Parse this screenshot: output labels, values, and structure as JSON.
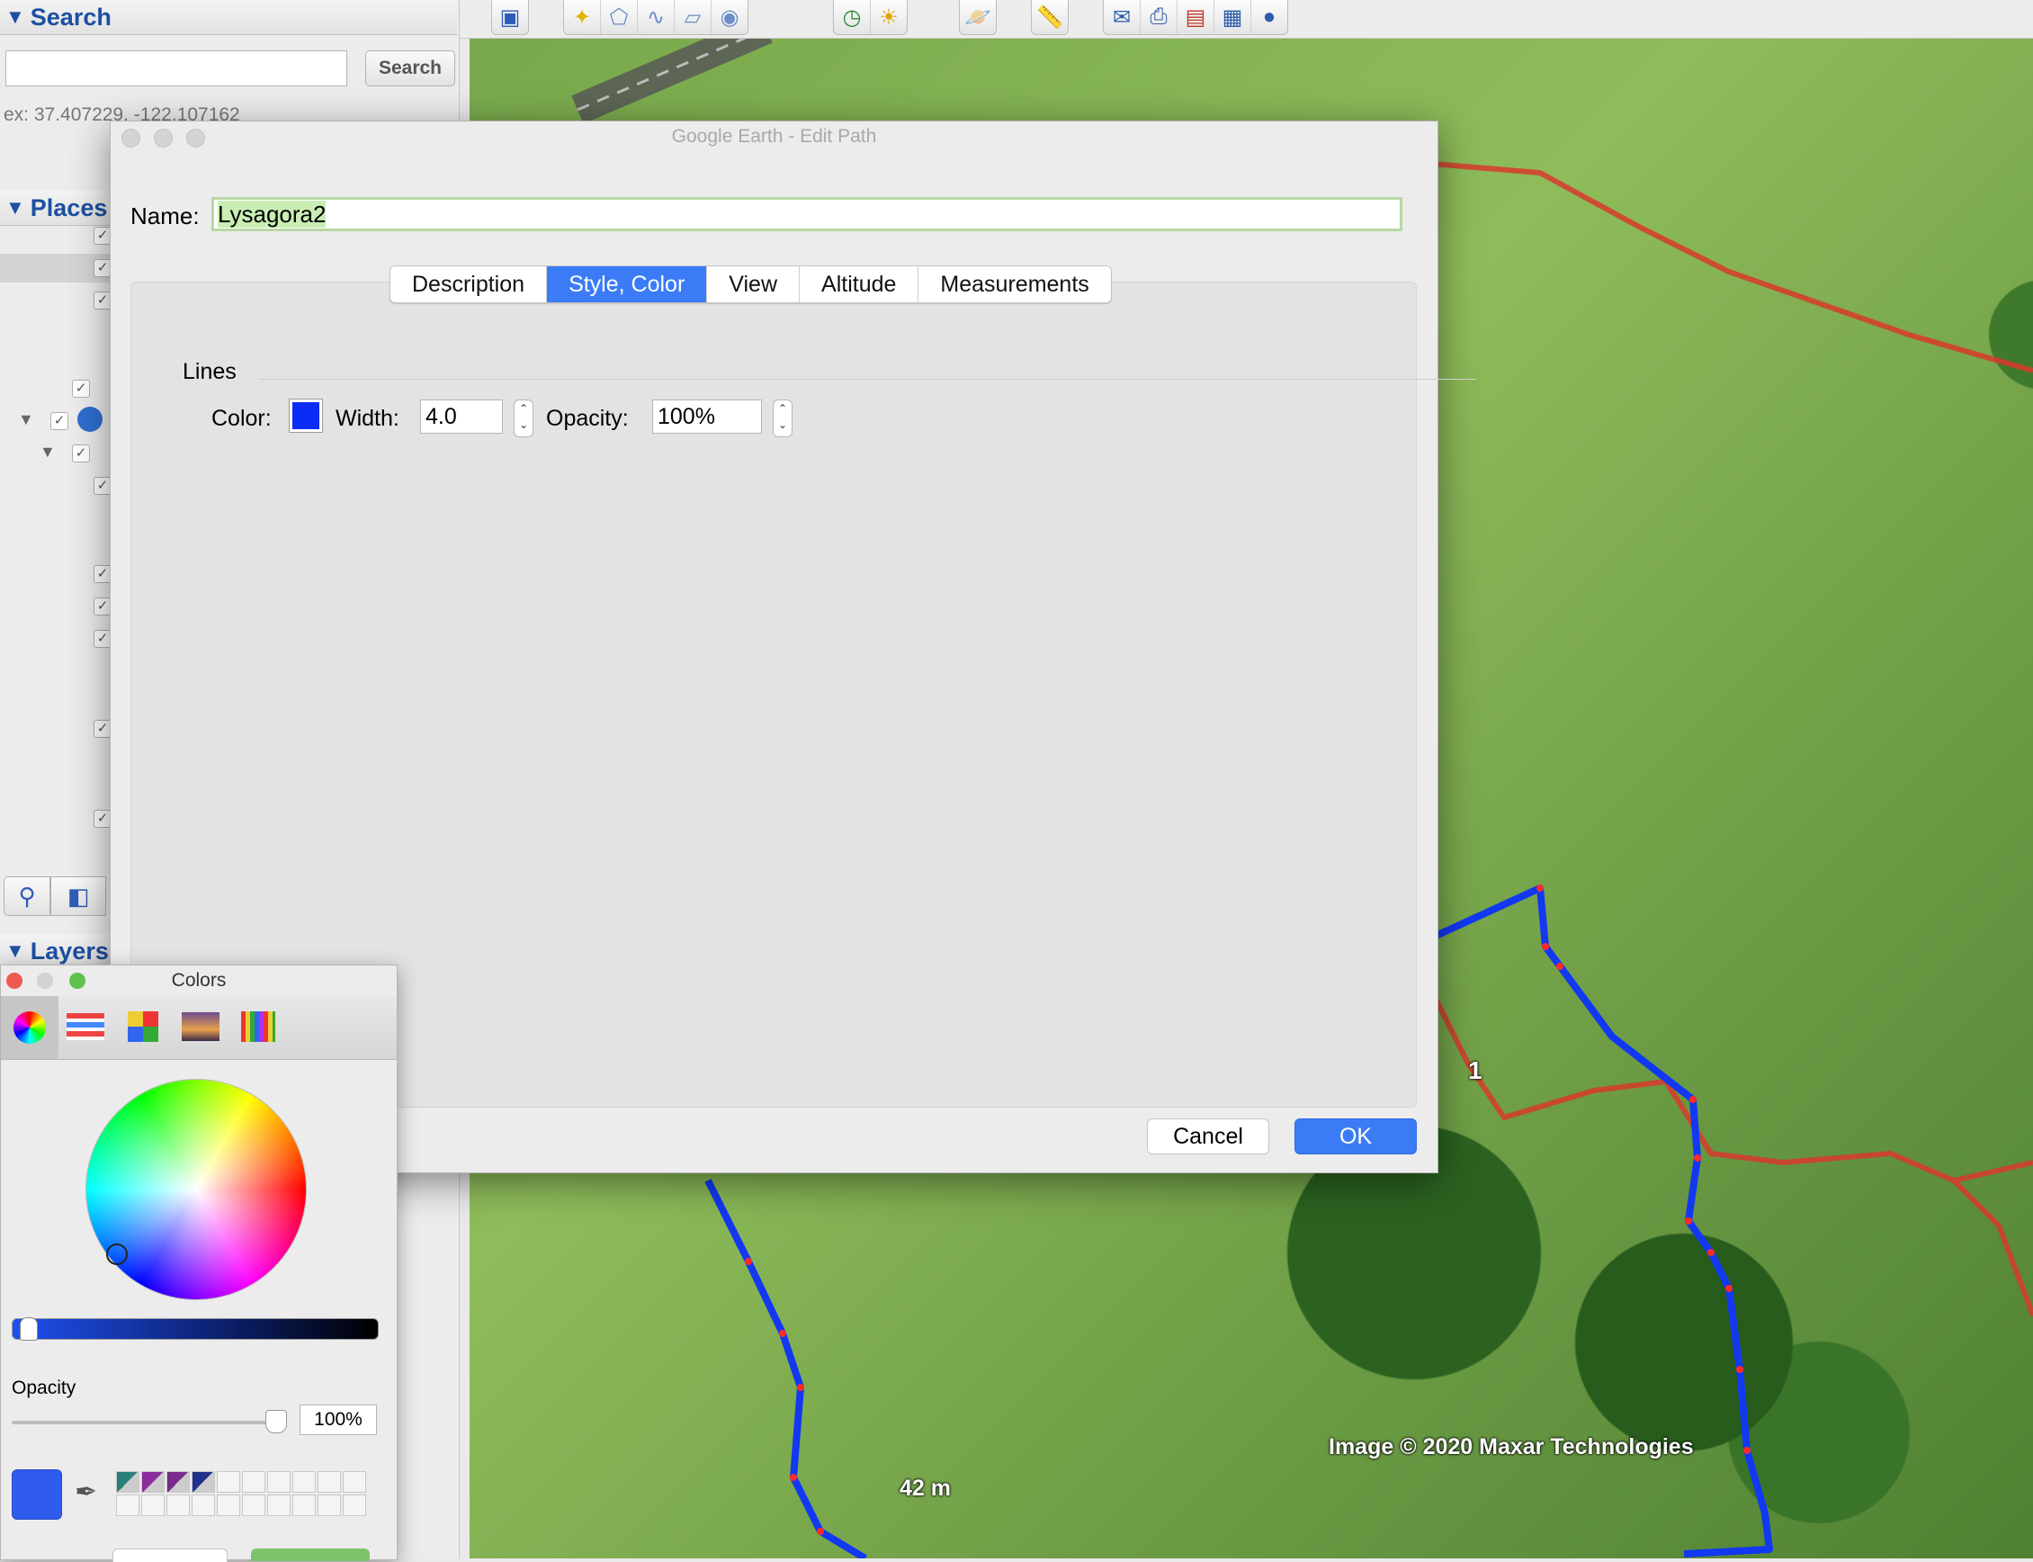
{
  "sidebar": {
    "search_header": "Search",
    "search_button": "Search",
    "search_hint": "ex: 37.407229, -122.107162",
    "places_header": "Places",
    "layers_header": "Layers"
  },
  "map": {
    "attribution": "Image © 2020 Maxar Technologies",
    "scale_label": "42 m",
    "marker_label": "1",
    "colors": {
      "path_blue": "#1238f2",
      "path_red": "#d8392b",
      "vertex": "#ff2a2a"
    }
  },
  "dialog": {
    "title": "Google Earth - Edit Path",
    "name_label": "Name:",
    "name_value": "Lysagora2",
    "tabs": [
      {
        "label": "Description",
        "active": false
      },
      {
        "label": "Style, Color",
        "active": true
      },
      {
        "label": "View",
        "active": false
      },
      {
        "label": "Altitude",
        "active": false
      },
      {
        "label": "Measurements",
        "active": false
      }
    ],
    "section_label": "Lines",
    "color_label": "Color:",
    "line_color": "#0a2cf5",
    "width_label": "Width:",
    "width_value": "4.0",
    "opacity_label": "Opacity:",
    "opacity_value": "100%",
    "cancel_label": "Cancel",
    "ok_label": "OK"
  },
  "colors_panel": {
    "title": "Colors",
    "opacity_label": "Opacity",
    "opacity_value": "100%",
    "current_color": "#2f5bef",
    "opacity_level": 1.0
  }
}
